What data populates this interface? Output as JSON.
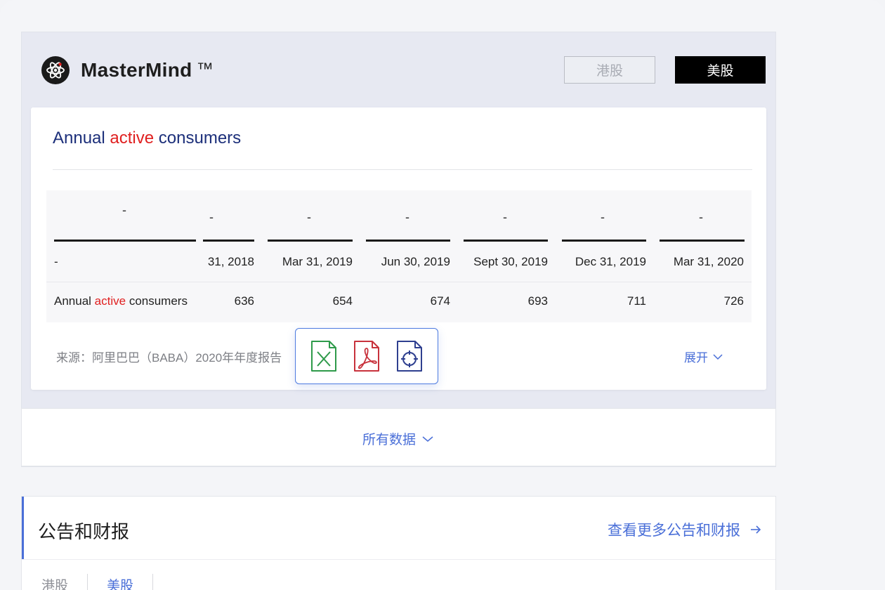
{
  "brand": {
    "name": "MasterMind",
    "tm": "™"
  },
  "market_buttons": {
    "hk": "港股",
    "us": "美股"
  },
  "card": {
    "title": {
      "part1": "Annual ",
      "highlight": "active",
      "part2": " consumers"
    },
    "table": {
      "header_dashes": [
        "-",
        "-",
        "-",
        "-",
        "-",
        "-",
        "-"
      ],
      "dates": [
        "-",
        "31, 2018",
        "Mar 31, 2019",
        "Jun 30, 2019",
        "Sept 30, 2019",
        "Dec 31, 2019",
        "Mar 31, 2020"
      ],
      "row": {
        "label_part1": "Annual ",
        "label_highlight": "active",
        "label_part2": " consumers",
        "values": [
          "636",
          "654",
          "674",
          "693",
          "711",
          "726"
        ]
      }
    },
    "source": "来源：阿里巴巴（BABA）2020年年度报告",
    "expand": "展开"
  },
  "popup_icons": [
    "excel-icon",
    "pdf-icon",
    "locate-icon"
  ],
  "all_data": "所有数据",
  "announcements": {
    "title": "公告和财报",
    "more": "查看更多公告和财报",
    "tabs": [
      "港股",
      "美股"
    ]
  },
  "colors": {
    "title_navy": "#1c2f7a",
    "highlight_red": "#e02020",
    "link_blue": "#4a6fd8",
    "excel_green": "#2e9a4a",
    "pdf_red": "#c8323c",
    "locate_navy": "#2e3f8f"
  }
}
